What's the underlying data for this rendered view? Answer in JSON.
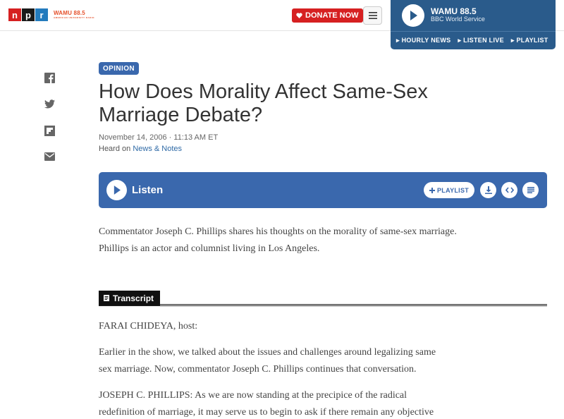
{
  "header": {
    "logo_letters": [
      "n",
      "p",
      "r"
    ],
    "station_logo": "WAMU 88.5",
    "station_tagline": "AMERICAN UNIVERSITY RADIO",
    "donate_label": "DONATE NOW",
    "menu_icon": "hamburger-icon"
  },
  "player": {
    "station_name": "WAMU 88.5",
    "program": "BBC World Service",
    "links": [
      "HOURLY NEWS",
      "LISTEN LIVE",
      "PLAYLIST"
    ]
  },
  "share_icons": [
    "facebook-icon",
    "twitter-icon",
    "flipboard-icon",
    "email-icon"
  ],
  "article": {
    "tag": "OPINION",
    "headline": "How Does Morality Affect Same-Sex Marriage Debate?",
    "date": "November 14, 2006 · 11:13 AM ET",
    "heard_on_prefix": "Heard on ",
    "heard_on_program": "News & Notes",
    "listen_label": "Listen",
    "playlist_label": "PLAYLIST",
    "summary": [
      "Commentator Joseph C. Phillips shares his thoughts on the morality of same-sex marriage.",
      "Phillips is an actor and columnist living in Los Angeles."
    ],
    "transcript_label": "Transcript",
    "transcript": [
      "FARAI CHIDEYA, host:",
      "Earlier in the show, we talked about the issues and challenges around legalizing same sex marriage. Now, commentator Joseph C. Phillips continues that conversation.",
      "JOSEPH C. PHILLIPS: As we are now standing at the precipice of the radical redefinition of marriage, it may serve us to begin to ask if there remain any objective standards by which we"
    ]
  },
  "colors": {
    "npr_red": "#d62021",
    "npr_blue": "#3a68ad",
    "player_blue": "#2a5b8b",
    "station_orange": "#e5502b"
  }
}
